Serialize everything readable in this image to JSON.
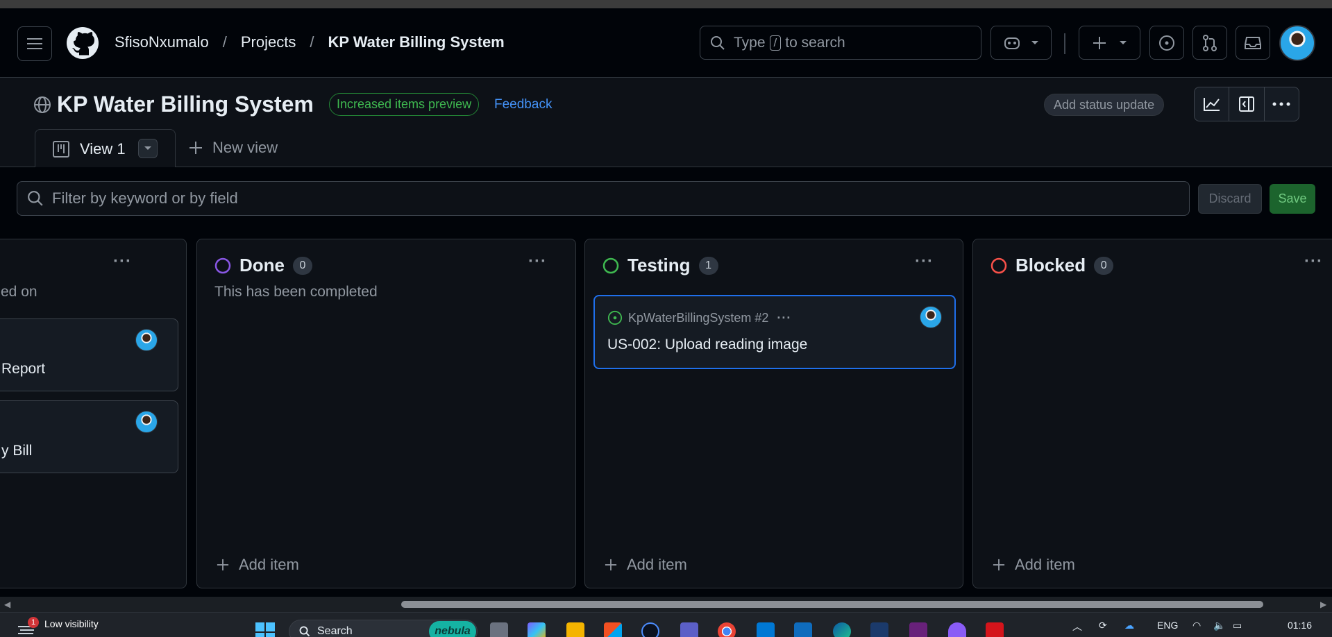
{
  "header": {
    "breadcrumbs": [
      "SfisoNxumalo",
      "Projects",
      "KP Water Billing System"
    ],
    "search_prefix": "Type",
    "search_key": "/",
    "search_suffix": "to search"
  },
  "project": {
    "title": "KP Water Billing System",
    "preview_label": "Increased items preview",
    "feedback_label": "Feedback",
    "status_update_label": "Add status update"
  },
  "tabs": {
    "active_label": "View 1",
    "new_view_label": "New view"
  },
  "filter": {
    "placeholder": "Filter by keyword or by field",
    "discard_label": "Discard",
    "save_label": "Save"
  },
  "board": {
    "add_item_label": "Add item",
    "columns": [
      {
        "name": "",
        "description": "ed on",
        "cards": [
          {
            "title": "Report"
          },
          {
            "title": "y Bill"
          }
        ]
      },
      {
        "name": "Done",
        "count": "0",
        "status_color": "#8957e5",
        "description": "This has been completed"
      },
      {
        "name": "Testing",
        "count": "1",
        "status_color": "#3fb950",
        "cards": [
          {
            "repo": "KpWaterBillingSystem #2",
            "title": "US-002: Upload reading image"
          }
        ]
      },
      {
        "name": "Blocked",
        "count": "0",
        "status_color": "#f85149"
      }
    ]
  },
  "taskbar": {
    "weather_badge": "1",
    "weather_text": "Low visibility",
    "search_label": "Search",
    "nebula_label": "nebula",
    "language": "ENG",
    "time": "01:16"
  },
  "colors": {
    "accent": "#1f6feb",
    "success": "#238636",
    "link": "#4493f8"
  }
}
